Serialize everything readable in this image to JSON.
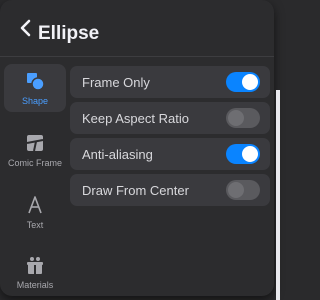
{
  "header": {
    "title": "Ellipse"
  },
  "sidebar": {
    "items": [
      {
        "label": "Shape",
        "icon": "shape-icon",
        "active": true
      },
      {
        "label": "Comic Frame",
        "icon": "comic-frame-icon",
        "active": false
      },
      {
        "label": "Text",
        "icon": "text-icon",
        "active": false
      },
      {
        "label": "Materials",
        "icon": "materials-icon",
        "active": false
      }
    ]
  },
  "settings": {
    "rows": [
      {
        "label": "Frame Only",
        "on": true
      },
      {
        "label": "Keep Aspect Ratio",
        "on": false
      },
      {
        "label": "Anti-aliasing",
        "on": true
      },
      {
        "label": "Draw From Center",
        "on": false
      }
    ]
  },
  "colors": {
    "accent": "#0a84ff",
    "panel": "#2c2c2e",
    "row": "#3a3a3e"
  }
}
